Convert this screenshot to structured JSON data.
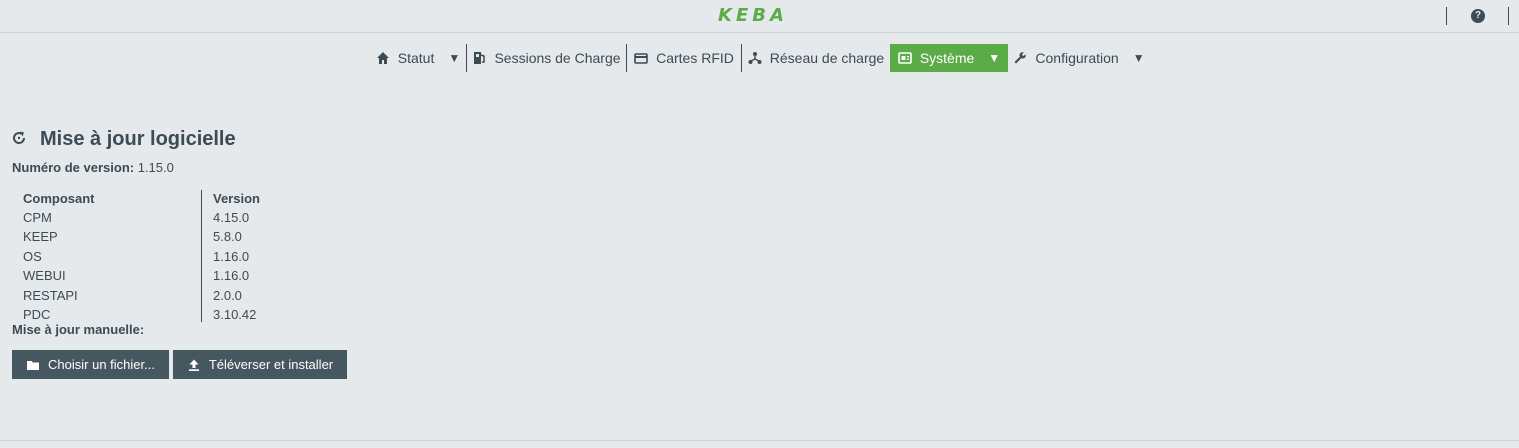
{
  "header": {
    "logo_text": "KEBA",
    "help_label": "?"
  },
  "nav": {
    "items": [
      {
        "label": "Statut",
        "icon": "home-icon",
        "has_caret": true,
        "caret": "▼"
      },
      {
        "label": "Sessions de Charge",
        "icon": "sessions-icon"
      },
      {
        "label": "Cartes RFID",
        "icon": "card-icon"
      },
      {
        "label": "Réseau de charge",
        "icon": "network-icon"
      },
      {
        "label": "Système",
        "icon": "system-icon",
        "has_caret": true,
        "caret": "▼",
        "active": true
      },
      {
        "label": "Configuration",
        "icon": "wrench-icon",
        "has_caret": true,
        "caret": "▼"
      }
    ]
  },
  "main": {
    "title": "Mise à jour logicielle",
    "version_label": "Numéro de version:",
    "version_value": "1.15.0",
    "components": {
      "headers": [
        "Composant",
        "Version"
      ],
      "rows": [
        [
          "CPM",
          "4.15.0"
        ],
        [
          "KEEP",
          "5.8.0"
        ],
        [
          "OS",
          "1.16.0"
        ],
        [
          "WEBUI",
          "1.16.0"
        ],
        [
          "RESTAPI",
          "2.0.0"
        ],
        [
          "PDC",
          "3.10.42"
        ]
      ]
    },
    "manual_update_label": "Mise à jour manuelle:",
    "choose_file_label": "Choisir un fichier...",
    "upload_label": "Téléverser et installer"
  },
  "colors": {
    "accent": "#5bab47",
    "text": "#3d4b55",
    "button_bg": "#45575f",
    "background": "#e5e9ec"
  }
}
